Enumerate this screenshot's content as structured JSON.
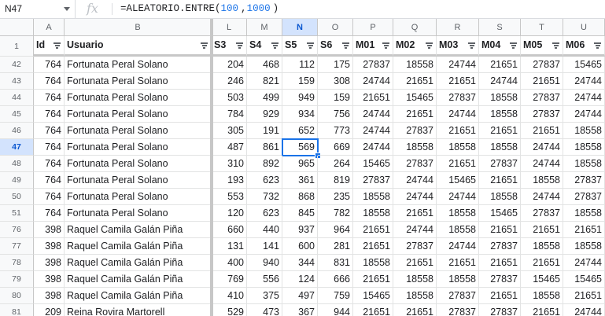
{
  "name_box": {
    "value": "N47"
  },
  "formula_bar": {
    "fx_label": "fx",
    "formula": "=ALEATORIO.ENTRE(100,1000)",
    "formula_prefix": "=ALEATORIO.ENTRE(",
    "arg1": "100",
    "comma": ",",
    "arg2": "1000",
    "suffix": ")"
  },
  "selected_cell": {
    "column": "N",
    "row": "47",
    "value": "569"
  },
  "columns": [
    "A",
    "B",
    "L",
    "M",
    "N",
    "O",
    "P",
    "Q",
    "R",
    "S",
    "T",
    "U"
  ],
  "headers": [
    "Id",
    "Usuario",
    "S3",
    "S4",
    "S5",
    "S6",
    "M01",
    "M02",
    "M03",
    "M04",
    "M05",
    "M06"
  ],
  "header_row_number": "1",
  "rows": [
    {
      "n": "42",
      "cells": [
        "764",
        "Fortunata Peral Solano",
        "204",
        "468",
        "112",
        "175",
        "27837",
        "18558",
        "24744",
        "21651",
        "27837",
        "15465"
      ]
    },
    {
      "n": "43",
      "cells": [
        "764",
        "Fortunata Peral Solano",
        "246",
        "821",
        "159",
        "308",
        "24744",
        "21651",
        "21651",
        "24744",
        "21651",
        "24744"
      ]
    },
    {
      "n": "44",
      "cells": [
        "764",
        "Fortunata Peral Solano",
        "503",
        "499",
        "949",
        "159",
        "21651",
        "15465",
        "27837",
        "18558",
        "27837",
        "24744"
      ]
    },
    {
      "n": "45",
      "cells": [
        "764",
        "Fortunata Peral Solano",
        "784",
        "929",
        "934",
        "756",
        "24744",
        "21651",
        "24744",
        "18558",
        "27837",
        "24744"
      ]
    },
    {
      "n": "46",
      "cells": [
        "764",
        "Fortunata Peral Solano",
        "305",
        "191",
        "652",
        "773",
        "24744",
        "27837",
        "21651",
        "21651",
        "21651",
        "18558"
      ]
    },
    {
      "n": "47",
      "cells": [
        "764",
        "Fortunata Peral Solano",
        "487",
        "861",
        "569",
        "669",
        "24744",
        "18558",
        "18558",
        "18558",
        "24744",
        "18558"
      ]
    },
    {
      "n": "48",
      "cells": [
        "764",
        "Fortunata Peral Solano",
        "310",
        "892",
        "965",
        "264",
        "15465",
        "27837",
        "21651",
        "27837",
        "24744",
        "18558"
      ]
    },
    {
      "n": "49",
      "cells": [
        "764",
        "Fortunata Peral Solano",
        "193",
        "623",
        "361",
        "819",
        "27837",
        "24744",
        "15465",
        "21651",
        "18558",
        "27837"
      ]
    },
    {
      "n": "50",
      "cells": [
        "764",
        "Fortunata Peral Solano",
        "553",
        "732",
        "868",
        "235",
        "18558",
        "24744",
        "24744",
        "18558",
        "24744",
        "27837"
      ]
    },
    {
      "n": "51",
      "cells": [
        "764",
        "Fortunata Peral Solano",
        "120",
        "623",
        "845",
        "782",
        "18558",
        "21651",
        "18558",
        "15465",
        "27837",
        "18558"
      ]
    },
    {
      "n": "76",
      "cells": [
        "398",
        "Raquel Camila Galán Piña",
        "660",
        "440",
        "937",
        "964",
        "21651",
        "24744",
        "18558",
        "21651",
        "21651",
        "21651"
      ]
    },
    {
      "n": "77",
      "cells": [
        "398",
        "Raquel Camila Galán Piña",
        "131",
        "141",
        "600",
        "281",
        "21651",
        "27837",
        "24744",
        "27837",
        "18558",
        "18558"
      ]
    },
    {
      "n": "78",
      "cells": [
        "398",
        "Raquel Camila Galán Piña",
        "400",
        "940",
        "344",
        "831",
        "18558",
        "21651",
        "21651",
        "21651",
        "21651",
        "24744"
      ]
    },
    {
      "n": "79",
      "cells": [
        "398",
        "Raquel Camila Galán Piña",
        "769",
        "556",
        "124",
        "666",
        "21651",
        "18558",
        "18558",
        "27837",
        "15465",
        "15465"
      ]
    },
    {
      "n": "80",
      "cells": [
        "398",
        "Raquel Camila Galán Piña",
        "410",
        "375",
        "497",
        "759",
        "15465",
        "18558",
        "27837",
        "21651",
        "18558",
        "21651"
      ]
    },
    {
      "n": "81",
      "cells": [
        "209",
        "Reina Rovira Martorell",
        "529",
        "473",
        "367",
        "944",
        "21651",
        "21651",
        "27837",
        "27837",
        "21651",
        "24744"
      ]
    }
  ],
  "colors": {
    "selection": "#1a73e8",
    "header_bg": "#f8f9fa",
    "selected_header_bg": "#d3e3fd"
  }
}
